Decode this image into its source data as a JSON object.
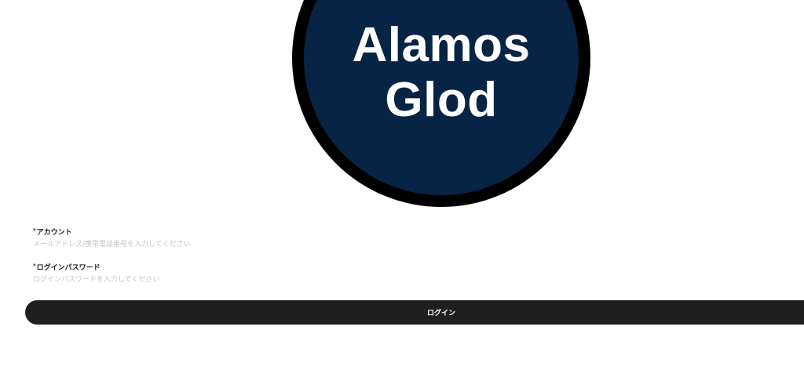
{
  "logo": {
    "line1": "Alamos",
    "line2": "Glod",
    "background_color": "#082444",
    "ring_color": "#000000"
  },
  "form": {
    "account": {
      "required_mark": "*",
      "label": "アカウント",
      "placeholder": "メールアドレス/携帯電話番号を入力してください",
      "value": ""
    },
    "password": {
      "required_mark": "*",
      "label": "ログインパスワード",
      "placeholder": "ログインパスワードを入力してください",
      "value": ""
    },
    "login_button_label": "ログイン",
    "button_color": "#1f1f1f"
  }
}
